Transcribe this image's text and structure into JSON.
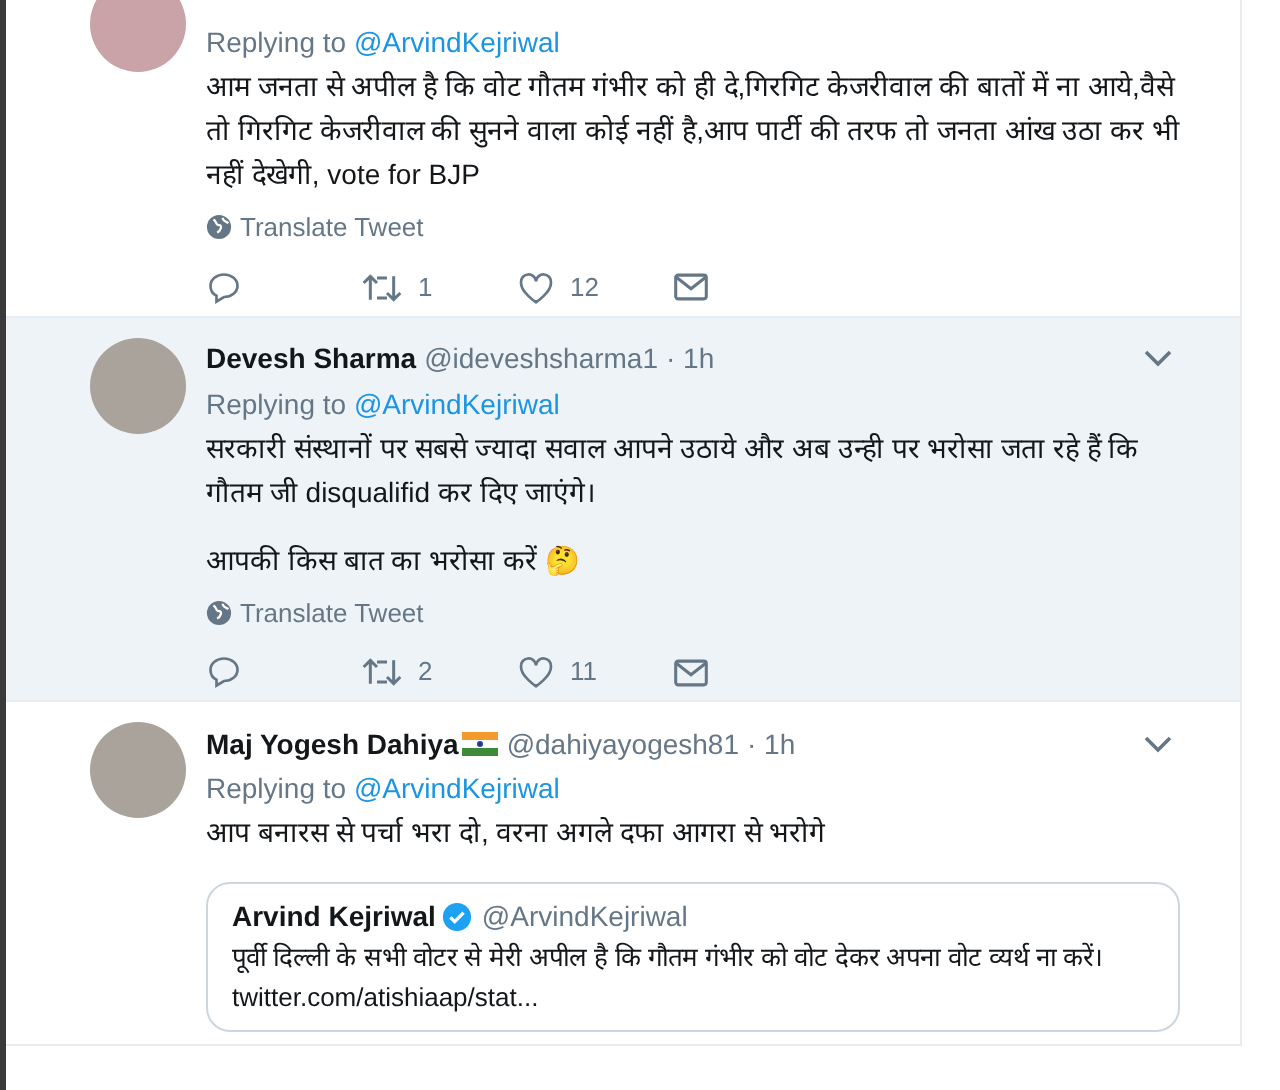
{
  "tweets": [
    {
      "highlighted": false,
      "replying_label": "Replying to",
      "replying_to": "@ArvindKejriwal",
      "paragraphs": [
        "आम जनता से अपील है कि वोट गौतम गंभीर को ही दे,गिरगिट केजरीवाल की बातों में ना आये,वैसे तो गिरगिट केजरीवाल की सुनने वाला कोई नहीं है,आप पार्टी की तरफ तो जनता आंख उठा कर भी नहीं देखेगी, vote for BJP"
      ],
      "translate": "Translate Tweet",
      "retweets": "1",
      "likes": "12"
    },
    {
      "highlighted": true,
      "header": {
        "name": "Devesh Sharma",
        "flag": false,
        "handle": "@ideveshsharma1",
        "time": "· 1h"
      },
      "replying_label": "Replying to",
      "replying_to": "@ArvindKejriwal",
      "paragraphs": [
        "सरकारी संस्थानों पर सबसे ज्यादा सवाल आपने उठाये और अब उन्ही पर भरोसा जता रहे हैं कि गौतम जी disqualifid कर दिए जाएंगे।",
        "आपकी किस बात का भरोसा करें 🤔"
      ],
      "translate": "Translate Tweet",
      "retweets": "2",
      "likes": "11"
    },
    {
      "highlighted": false,
      "header": {
        "name": "Maj Yogesh Dahiya",
        "flag": true,
        "handle": "@dahiyayogesh81",
        "time": "· 1h"
      },
      "replying_label": "Replying to",
      "replying_to": "@ArvindKejriwal",
      "paragraphs": [
        "आप बनारस से पर्चा भरा दो, वरना अगले दफा आगरा से भरोगे"
      ],
      "quote": {
        "name": "Arvind Kejriwal",
        "verified": true,
        "handle": "@ArvindKejriwal",
        "text": "पूर्वी दिल्ली के सभी वोटर से मेरी अपील है कि गौतम गंभीर को वोट देकर अपना वोट व्यर्थ ना करें। twitter.com/atishiaap/stat..."
      }
    }
  ]
}
